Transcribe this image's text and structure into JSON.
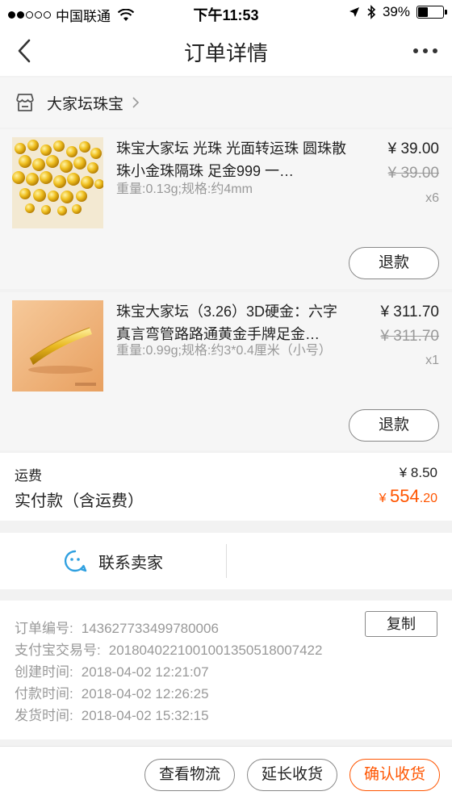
{
  "status_bar": {
    "carrier": "中国联通",
    "time": "下午11:53",
    "battery": "39%",
    "battery_level": 0.39,
    "signal_bars": 2
  },
  "nav": {
    "title": "订单详情",
    "back_icon": "chevron-left-icon",
    "more_icon": "more-icon"
  },
  "shop": {
    "name": "大家坛珠宝",
    "icon": "store-icon"
  },
  "items": [
    {
      "name": "珠宝大家坛 光珠 光面转运珠 圆珠散珠小金珠隔珠 足金999 一…",
      "spec": "重量:0.13g;规格:约4mm",
      "price": "¥ 39.00",
      "original_price": "¥ 39.00",
      "quantity": "x6",
      "refund_label": "退款"
    },
    {
      "name": "珠宝大家坛（3.26）3D硬金：六字真言弯管路路通黄金手牌足金…",
      "spec": "重量:0.99g;规格:约3*0.4厘米（小号）",
      "price": "¥ 311.70",
      "original_price": "¥ 311.70",
      "quantity": "x1",
      "refund_label": "退款"
    }
  ],
  "totals": {
    "shipping_label": "运费",
    "shipping_value": "¥ 8.50",
    "paid_label": "实付款（含运费）",
    "paid_currency": "¥",
    "paid_integer": "554",
    "paid_decimal": ".20"
  },
  "contact": {
    "label": "联系卖家",
    "icon": "chat-face-icon"
  },
  "order_info": {
    "order_no_label": "订单编号:",
    "order_no": "143627733499780006",
    "copy_label": "复制",
    "alipay_label": "支付宝交易号:",
    "alipay_no": "2018040221001001350518007422",
    "created_label": "创建时间:",
    "created": "2018-04-02 12:21:07",
    "paid_label": "付款时间:",
    "paid": "2018-04-02 12:26:25",
    "shipped_label": "发货时间:",
    "shipped": "2018-04-02 15:32:15"
  },
  "actions": {
    "logistics": "查看物流",
    "extend": "延长收货",
    "confirm": "确认收货"
  },
  "colors": {
    "accent": "#ff5500",
    "muted": "#999999"
  }
}
